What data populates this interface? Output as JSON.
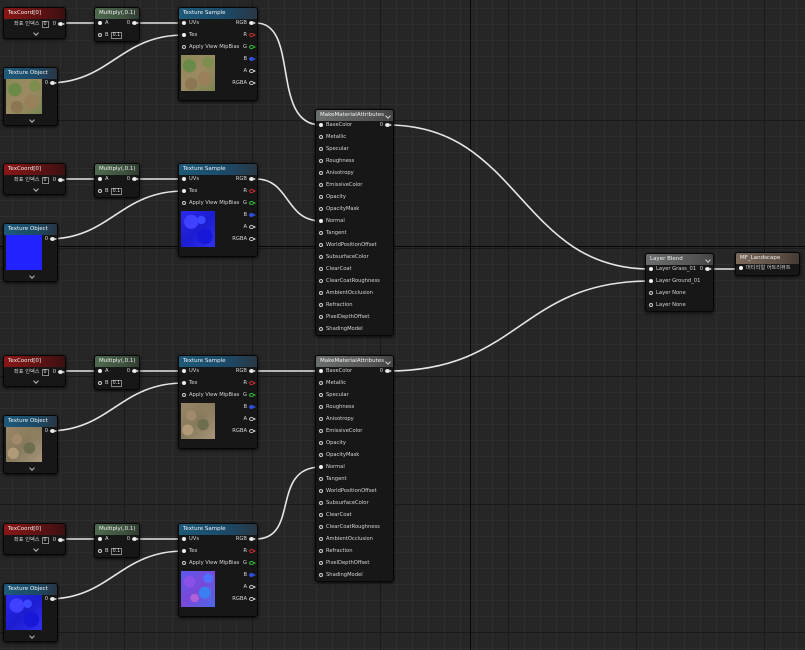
{
  "texcoord": {
    "title": "TexCoord[0]",
    "label": "좌표 인덱스",
    "index": "0",
    "out": "0"
  },
  "multiply": {
    "title": "Multiply(,0.1)",
    "a": "A",
    "b": "B",
    "b_value": "0.1",
    "out": "0"
  },
  "texture_sample": {
    "title": "Texture Sample",
    "uvs": "UVs",
    "tex": "Tex",
    "mip": "Apply View MipBias",
    "rgb": "RGB",
    "r": "R",
    "g": "G",
    "b": "B",
    "a": "A",
    "rgba": "RGBA"
  },
  "texture_object": {
    "title": "Texture Object",
    "out": "0"
  },
  "make_material": {
    "title": "MakeMaterialAttributes",
    "out": "0",
    "pins": [
      "BaseColor",
      "Metallic",
      "Specular",
      "Roughness",
      "Anisotropy",
      "EmissiveColor",
      "Opacity",
      "OpacityMask",
      "Normal",
      "Tangent",
      "WorldPositionOffset",
      "SubsurfaceColor",
      "ClearCoat",
      "ClearCoatRoughness",
      "AmbientOcclusion",
      "Refraction",
      "PixelDepthOffset",
      "ShadingModel"
    ]
  },
  "layer_blend": {
    "title": "Layer Blend",
    "out": "0",
    "layers": [
      "Layer Grass_01",
      "Layer Ground_01",
      "Layer None",
      "Layer None"
    ]
  },
  "material_output": {
    "title": "MF_Landscape",
    "input": "머티리얼 어트리뷰트"
  },
  "colors": {
    "grid_bg": "#262626",
    "wire": "#e6e6e6",
    "texcoord_header": "#8a1616",
    "multiply_header": "#4e6a4e",
    "texture_header": "#1e5a7a"
  }
}
